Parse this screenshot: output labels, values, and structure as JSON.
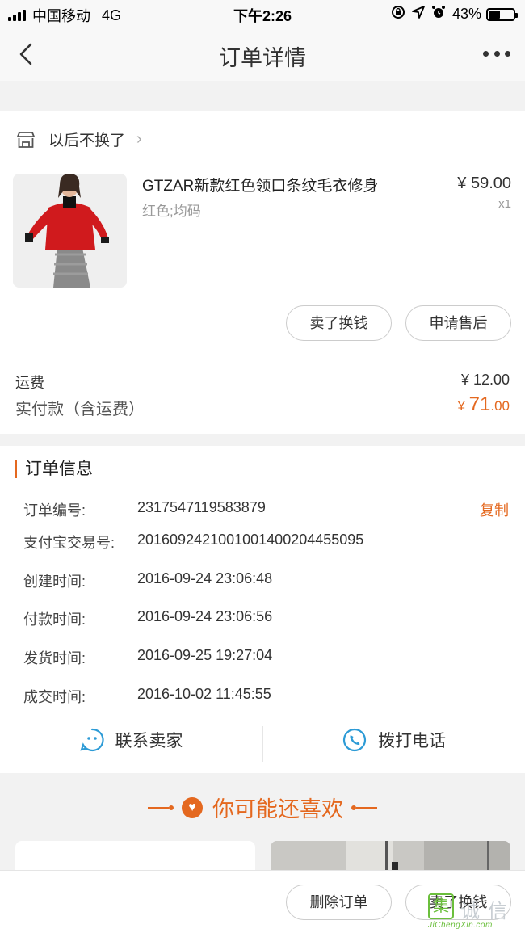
{
  "status_bar": {
    "carrier": "中国移动",
    "network": "4G",
    "time": "下午2:26",
    "battery_percent": "43%",
    "battery_level": 0.43,
    "icons": [
      "lock-rotation-icon",
      "location-arrow-icon",
      "alarm-icon"
    ]
  },
  "nav": {
    "title": "订单详情",
    "back_icon": "chevron-left-icon",
    "more_icon": "more-dots-icon"
  },
  "shop": {
    "name": "以后不换了",
    "icon": "store-icon",
    "chevron": "›"
  },
  "product": {
    "name": "GTZAR新款红色领口条纹毛衣修身",
    "spec": "红色;均码",
    "price": "¥ 59.00",
    "qty": "x1"
  },
  "actions": {
    "sell_label": "卖了换钱",
    "after_sale_label": "申请售后"
  },
  "fees": {
    "shipping_label": "运费",
    "shipping_value": "¥ 12.00",
    "paid_label": "实付款（含运费）",
    "paid_currency": "¥ ",
    "paid_integer": "71",
    "paid_decimal": ".00"
  },
  "order_info": {
    "title": "订单信息",
    "copy_label": "复制",
    "rows": [
      {
        "label": "订单编号:",
        "value": "2317547119583879"
      },
      {
        "label": "支付宝交易号:",
        "value": "2016092421001001400204455095"
      },
      {
        "label": "创建时间:",
        "value": "2016-09-24 23:06:48"
      },
      {
        "label": "付款时间:",
        "value": "2016-09-24 23:06:56"
      },
      {
        "label": "发货时间:",
        "value": "2016-09-25 19:27:04"
      },
      {
        "label": "成交时间:",
        "value": "2016-10-02 11:45:55"
      }
    ],
    "contact_seller": "联系卖家",
    "call_phone": "拨打电话"
  },
  "recommend": {
    "title": "你可能还喜欢"
  },
  "bottom": {
    "delete_label": "删除订单",
    "sell_label": "卖了换钱"
  },
  "watermark": {
    "mark": "集",
    "chars": [
      "诚",
      "信"
    ],
    "url": "JiChengXin.com"
  },
  "colors": {
    "accent": "#e4681f",
    "contact_icon": "#2d9bd6"
  }
}
